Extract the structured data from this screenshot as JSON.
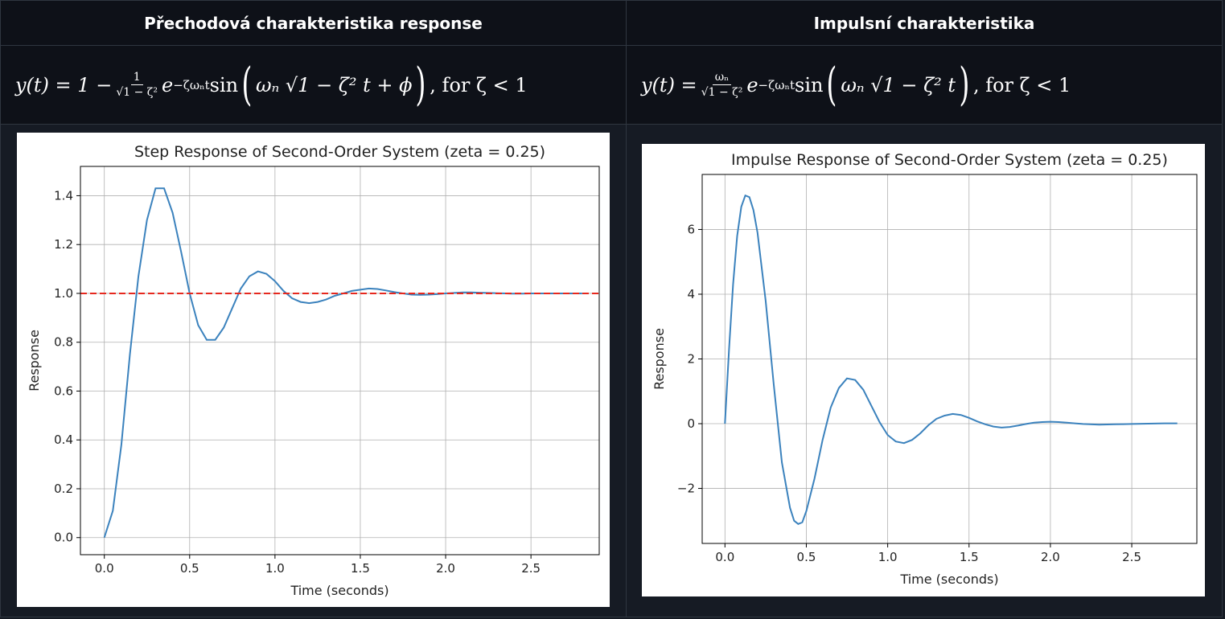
{
  "headers": {
    "left": "Přechodová charakteristika response",
    "right": "Impulsní charakteristika"
  },
  "formulas": {
    "left": {
      "lhs": "y(t) = 1 −",
      "frac_num": "1",
      "frac_den": "√1 − ζ²",
      "exp": "e",
      "exp_sup": "−ζωₙt",
      "func": "sin",
      "arg": "ωₙ √1 − ζ² t + ϕ",
      "cond": ", for ζ < 1"
    },
    "right": {
      "lhs": "y(t) =",
      "frac_num": "ωₙ",
      "frac_den": "√1 − ζ²",
      "exp": "e",
      "exp_sup": "−ζωₙt",
      "func": "sin",
      "arg": "ωₙ √1 − ζ² t",
      "cond": ", for ζ < 1"
    }
  },
  "chart_data": [
    {
      "type": "line",
      "title": "Step Response of Second-Order System (zeta = 0.25)",
      "xlabel": "Time (seconds)",
      "ylabel": "Response",
      "xlim": [
        -0.14,
        2.9
      ],
      "ylim": [
        -0.07,
        1.52
      ],
      "xticks": [
        0.0,
        0.5,
        1.0,
        1.5,
        2.0,
        2.5
      ],
      "xtick_labels": [
        "0.0",
        "0.5",
        "1.0",
        "1.5",
        "2.0",
        "2.5"
      ],
      "yticks": [
        0.0,
        0.2,
        0.4,
        0.6,
        0.8,
        1.0,
        1.2,
        1.4
      ],
      "ytick_labels": [
        "0.0",
        "0.2",
        "0.4",
        "0.6",
        "0.8",
        "1.0",
        "1.2",
        "1.4"
      ],
      "grid": true,
      "reference_line": {
        "y": 1.0,
        "color": "#e6281e",
        "style": "dashed"
      },
      "series": [
        {
          "color": "#3b82bd",
          "x": [
            0.0,
            0.05,
            0.1,
            0.15,
            0.2,
            0.25,
            0.3,
            0.35,
            0.4,
            0.45,
            0.5,
            0.55,
            0.6,
            0.65,
            0.7,
            0.75,
            0.8,
            0.85,
            0.9,
            0.95,
            1.0,
            1.05,
            1.1,
            1.15,
            1.2,
            1.25,
            1.3,
            1.35,
            1.4,
            1.45,
            1.5,
            1.55,
            1.6,
            1.65,
            1.7,
            1.75,
            1.8,
            1.85,
            1.9,
            1.95,
            2.0,
            2.05,
            2.1,
            2.15,
            2.2,
            2.25,
            2.3,
            2.35,
            2.4,
            2.45,
            2.5,
            2.55,
            2.6,
            2.65,
            2.7,
            2.75,
            2.8
          ],
          "y": [
            0.0,
            0.11,
            0.38,
            0.75,
            1.07,
            1.3,
            1.43,
            1.43,
            1.33,
            1.17,
            1.0,
            0.87,
            0.81,
            0.81,
            0.86,
            0.94,
            1.02,
            1.07,
            1.09,
            1.08,
            1.05,
            1.01,
            0.98,
            0.965,
            0.96,
            0.965,
            0.975,
            0.99,
            1.0,
            1.01,
            1.015,
            1.02,
            1.018,
            1.012,
            1.005,
            1.0,
            0.995,
            0.994,
            0.995,
            0.997,
            1.0,
            1.002,
            1.004,
            1.004,
            1.003,
            1.002,
            1.001,
            1.0,
            0.999,
            0.999,
            1.0,
            1.0,
            1.0,
            1.0,
            1.0,
            1.0,
            1.0
          ]
        }
      ]
    },
    {
      "type": "line",
      "title": "Impulse Response of Second-Order System (zeta = 0.25)",
      "xlabel": "Time (seconds)",
      "ylabel": "Response",
      "xlim": [
        -0.14,
        2.9
      ],
      "ylim": [
        -3.7,
        7.7
      ],
      "xticks": [
        0.0,
        0.5,
        1.0,
        1.5,
        2.0,
        2.5
      ],
      "xtick_labels": [
        "0.0",
        "0.5",
        "1.0",
        "1.5",
        "2.0",
        "2.5"
      ],
      "yticks": [
        -2,
        0,
        2,
        4,
        6
      ],
      "ytick_labels": [
        "−2",
        "0",
        "2",
        "4",
        "6"
      ],
      "grid": true,
      "series": [
        {
          "color": "#3b82bd",
          "x": [
            0.0,
            0.025,
            0.05,
            0.075,
            0.1,
            0.125,
            0.15,
            0.175,
            0.2,
            0.25,
            0.3,
            0.35,
            0.4,
            0.425,
            0.45,
            0.475,
            0.5,
            0.55,
            0.6,
            0.65,
            0.7,
            0.75,
            0.8,
            0.85,
            0.9,
            0.95,
            1.0,
            1.05,
            1.1,
            1.15,
            1.2,
            1.25,
            1.3,
            1.35,
            1.4,
            1.45,
            1.5,
            1.55,
            1.6,
            1.65,
            1.7,
            1.75,
            1.8,
            1.85,
            1.9,
            1.95,
            2.0,
            2.05,
            2.1,
            2.15,
            2.2,
            2.3,
            2.4,
            2.5,
            2.6,
            2.7,
            2.78
          ],
          "y": [
            0.0,
            2.3,
            4.3,
            5.8,
            6.7,
            7.05,
            7.0,
            6.6,
            5.9,
            3.8,
            1.2,
            -1.2,
            -2.6,
            -3.0,
            -3.1,
            -3.05,
            -2.7,
            -1.7,
            -0.5,
            0.5,
            1.1,
            1.4,
            1.35,
            1.05,
            0.55,
            0.05,
            -0.35,
            -0.55,
            -0.6,
            -0.5,
            -0.3,
            -0.05,
            0.15,
            0.25,
            0.3,
            0.27,
            0.18,
            0.07,
            -0.02,
            -0.09,
            -0.12,
            -0.1,
            -0.06,
            -0.01,
            0.03,
            0.05,
            0.06,
            0.05,
            0.03,
            0.01,
            -0.01,
            -0.03,
            -0.02,
            -0.01,
            0.0,
            0.01,
            0.01
          ]
        }
      ]
    }
  ]
}
